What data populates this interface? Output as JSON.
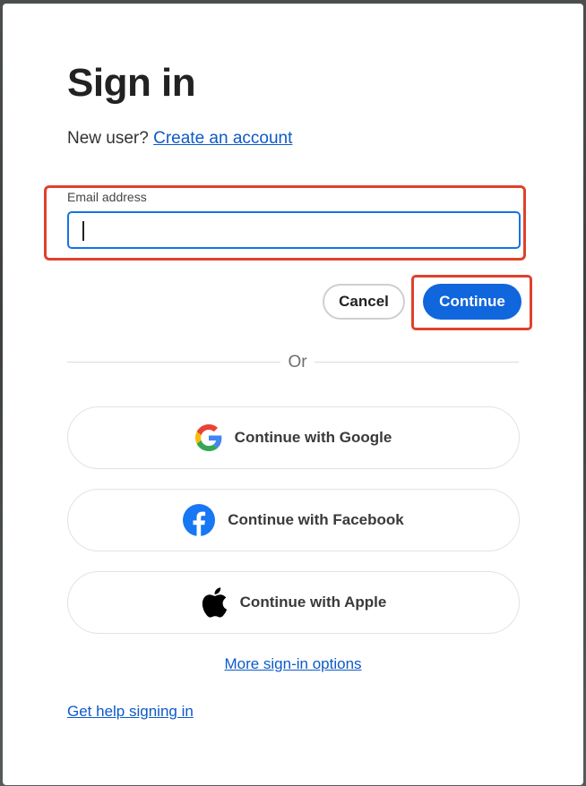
{
  "signin": {
    "title": "Sign in",
    "new_user_text": "New user?",
    "create_account_link": "Create an account"
  },
  "email": {
    "label": "Email address",
    "value": "",
    "placeholder": ""
  },
  "actions": {
    "cancel_label": "Cancel",
    "continue_label": "Continue"
  },
  "divider": {
    "text": "Or"
  },
  "social": {
    "google_label": "Continue with Google",
    "facebook_label": "Continue with Facebook",
    "apple_label": "Continue with Apple",
    "facebook_color": "#1877F2"
  },
  "links": {
    "more_options": "More sign-in options",
    "help": "Get help signing in"
  },
  "colors": {
    "primary": "#1066DC",
    "link": "#0D5AC8",
    "highlight": "#E0412B"
  }
}
